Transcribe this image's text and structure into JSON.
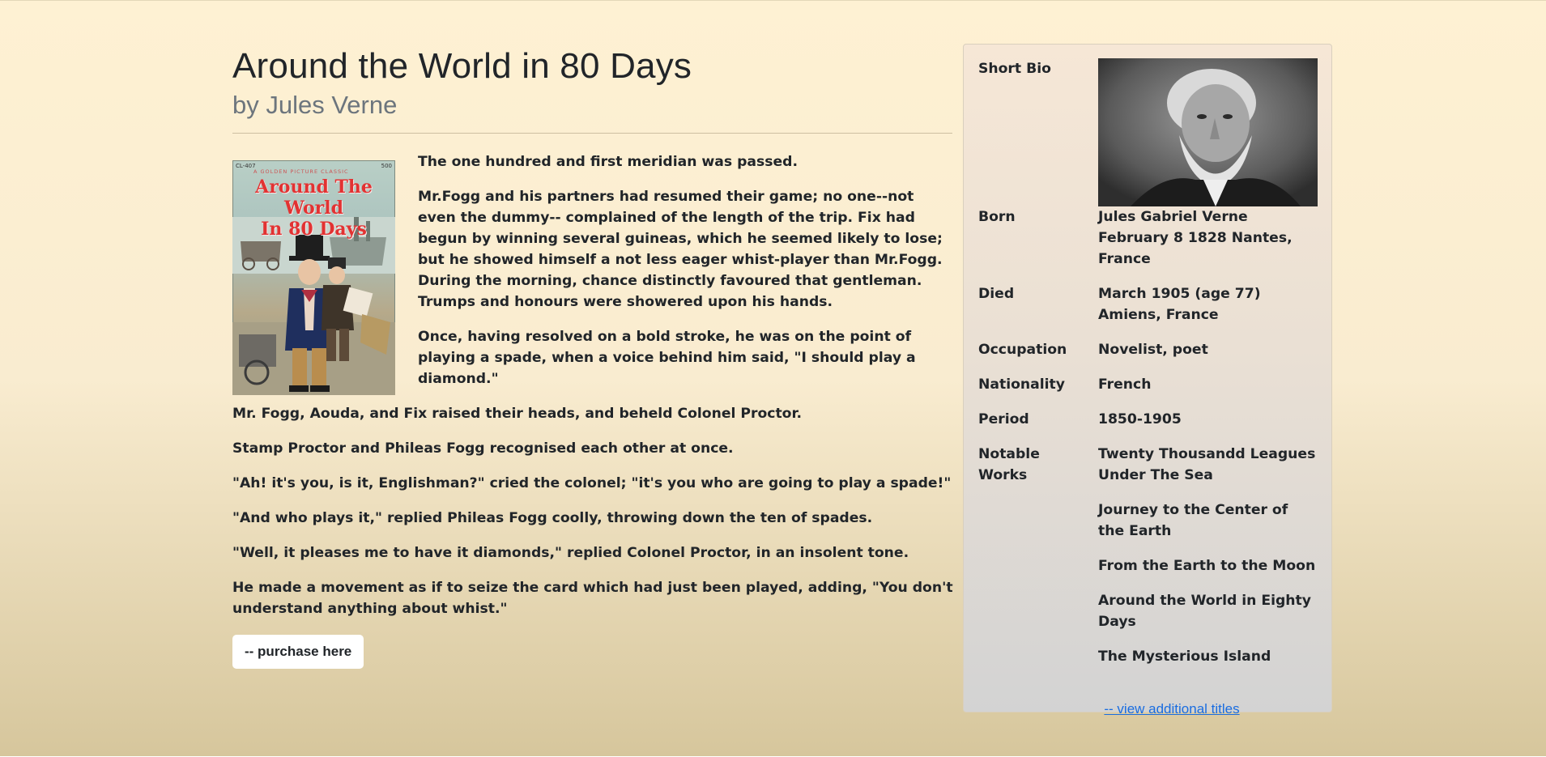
{
  "book": {
    "title": "Around the World in 80 Days",
    "author_line": "by Jules Verne"
  },
  "cover": {
    "series_code": "CL-407",
    "series_price": "500",
    "series_name": "A GOLDEN PICTURE CLASSIC",
    "title_line1": "Around The World",
    "title_line2": "In 80 Days"
  },
  "story": {
    "paragraphs_beside_cover": [
      "The one hundred and first meridian was passed.",
      "Mr.Fogg and his partners had resumed their game; no one--not even the dummy-- complained of the length of the trip. Fix had begun by winning several guineas, which he seemed likely to lose; but he showed himself a not less eager whist-player than Mr.Fogg. During the morning, chance distinctly favoured that gentleman. Trumps and honours were showered upon his hands.",
      "Once, having resolved on a bold stroke, he was on the point of playing a spade, when a voice behind him said, \"I should play a diamond.\""
    ],
    "paragraphs_below": [
      "Mr. Fogg, Aouda, and Fix raised their heads, and beheld Colonel Proctor.",
      "Stamp Proctor and Phileas Fogg recognised each other at once.",
      "\"Ah! it's you, is it, Englishman?\" cried the colonel; \"it's you who are going to play a spade!\"",
      "\"And who plays it,\" replied Phileas Fogg coolly, throwing down the ten of spades.",
      "\"Well, it pleases me to have it diamonds,\" replied Colonel Proctor, in an insolent tone.",
      "He made a movement as if to seize the card which had just been played, adding, \"You don't understand anything about whist.\""
    ],
    "purchase_label": "-- purchase here"
  },
  "bio": {
    "heading": "Short Bio",
    "born_label": "Born",
    "born_value": "Jules Gabriel Verne February 8 1828 Nantes, France",
    "died_label": "Died",
    "died_value": "March 1905 (age 77) Amiens, France",
    "occupation_label": "Occupation",
    "occupation_value": "Novelist, poet",
    "nationality_label": "Nationality",
    "nationality_value": "French",
    "period_label": "Period",
    "period_value": "1850-1905",
    "works_label": "Notable Works",
    "works": [
      "Twenty Thousandd Leagues Under The Sea",
      "Journey to the Center of the Earth",
      "From the Earth to the Moon",
      "Around the World in Eighty Days",
      "The Mysterious Island"
    ],
    "more_link": "-- view additional titles"
  }
}
